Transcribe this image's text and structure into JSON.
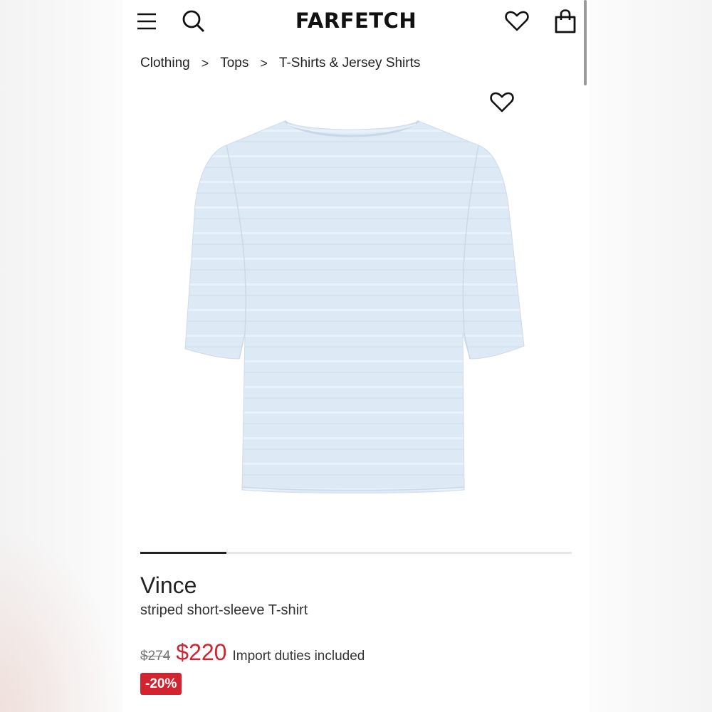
{
  "header": {
    "logo": "FARFETCH",
    "icons": [
      "menu-icon",
      "search-icon",
      "heart-icon",
      "shopping-bag-icon"
    ]
  },
  "breadcrumb": [
    {
      "label": "Clothing"
    },
    {
      "label": "Tops"
    },
    {
      "label": "T-Shirts & Jersey Shirts"
    }
  ],
  "breadcrumb_separator": ">",
  "gallery": {
    "current_image": 1,
    "progress_fraction": 0.2
  },
  "product": {
    "brand": "Vince",
    "name": "striped short-sleeve T-shirt",
    "original_price": "$274",
    "sale_price": "$220",
    "duties_note": "Import duties included",
    "discount": "-20%"
  },
  "colors": {
    "sale_red": "#d2232f",
    "text_dark": "#222222",
    "tshirt_blue": "#dde9f5"
  }
}
